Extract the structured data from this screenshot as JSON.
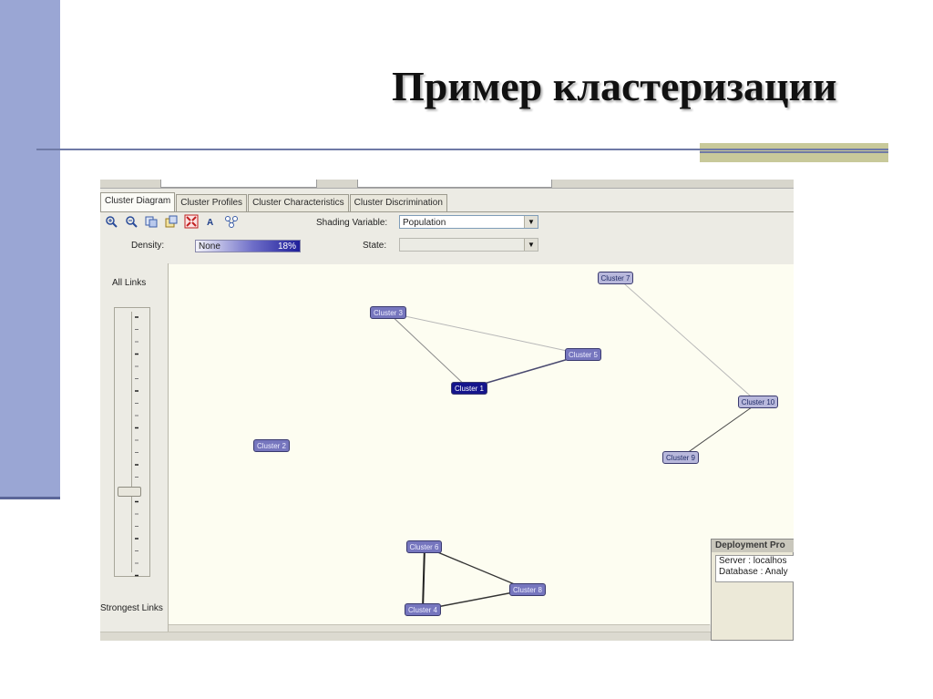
{
  "slide": {
    "title": "Пример кластеризации"
  },
  "app": {
    "tabs": [
      {
        "label": "Cluster Diagram",
        "active": true
      },
      {
        "label": "Cluster Profiles",
        "active": false
      },
      {
        "label": "Cluster Characteristics",
        "active": false
      },
      {
        "label": "Cluster Discrimination",
        "active": false
      }
    ],
    "toolbar_icons": [
      "zoom-in-icon",
      "zoom-out-icon",
      "copy-icon",
      "copy-graph-icon",
      "fit-to-window-icon",
      "font-icon",
      "layout-icon"
    ],
    "shading_label": "Shading Variable:",
    "shading_value": "Population",
    "density_label": "Density:",
    "density_min_label": "None",
    "density_max_label": "18%",
    "state_label": "State:",
    "state_value": "",
    "slider": {
      "top_label": "All Links",
      "bottom_label": "Strongest Links"
    },
    "nodes": [
      {
        "label": "Cluster 7",
        "shade": "light"
      },
      {
        "label": "Cluster 3",
        "shade": "mid"
      },
      {
        "label": "Cluster 5",
        "shade": "mid"
      },
      {
        "label": "Cluster 1",
        "shade": "dark"
      },
      {
        "label": "Cluster 10",
        "shade": "light"
      },
      {
        "label": "Cluster 2",
        "shade": "mid"
      },
      {
        "label": "Cluster 9",
        "shade": "light"
      },
      {
        "label": "Cluster 6",
        "shade": "mid"
      },
      {
        "label": "Cluster 8",
        "shade": "mid"
      },
      {
        "label": "Cluster 4",
        "shade": "mid"
      }
    ],
    "deployment": {
      "title": "Deployment Pro",
      "server_line": "Server : localhos",
      "database_line": "Database : Analy"
    },
    "colors": {
      "node_light": "#b8b8dc",
      "node_mid": "#7676be",
      "node_dark": "#14148c",
      "canvas": "#fdfdf1"
    }
  }
}
